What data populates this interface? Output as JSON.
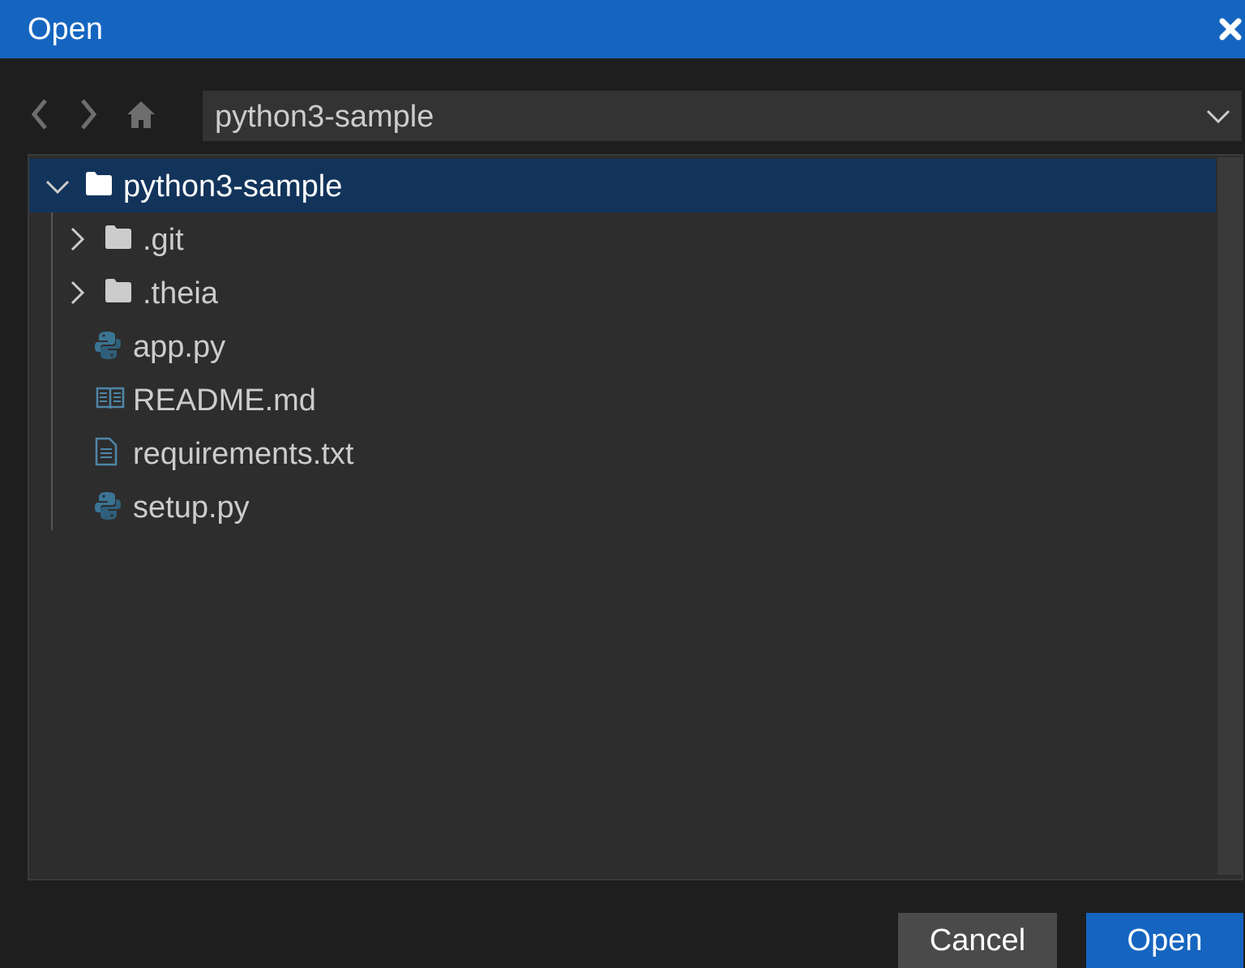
{
  "dialog": {
    "title": "Open",
    "close_icon": "close-icon",
    "accent_color": "#1565c0"
  },
  "navigation": {
    "back_icon": "chevron-left-icon",
    "forward_icon": "chevron-right-icon",
    "home_icon": "home-icon",
    "location": "python3-sample",
    "location_dropdown_icon": "chevron-down-icon"
  },
  "tree": {
    "root": {
      "label": "python3-sample",
      "expanded": true,
      "selected": true,
      "icon": "folder-icon"
    },
    "items": [
      {
        "label": ".git",
        "type": "folder",
        "icon": "folder-icon",
        "expanded": false
      },
      {
        "label": ".theia",
        "type": "folder",
        "icon": "folder-icon",
        "expanded": false
      },
      {
        "label": "app.py",
        "type": "file",
        "icon": "python-icon"
      },
      {
        "label": "README.md",
        "type": "file",
        "icon": "book-icon"
      },
      {
        "label": "requirements.txt",
        "type": "file",
        "icon": "text-file-icon"
      },
      {
        "label": "setup.py",
        "type": "file",
        "icon": "python-icon"
      }
    ]
  },
  "buttons": {
    "cancel": "Cancel",
    "open": "Open"
  }
}
